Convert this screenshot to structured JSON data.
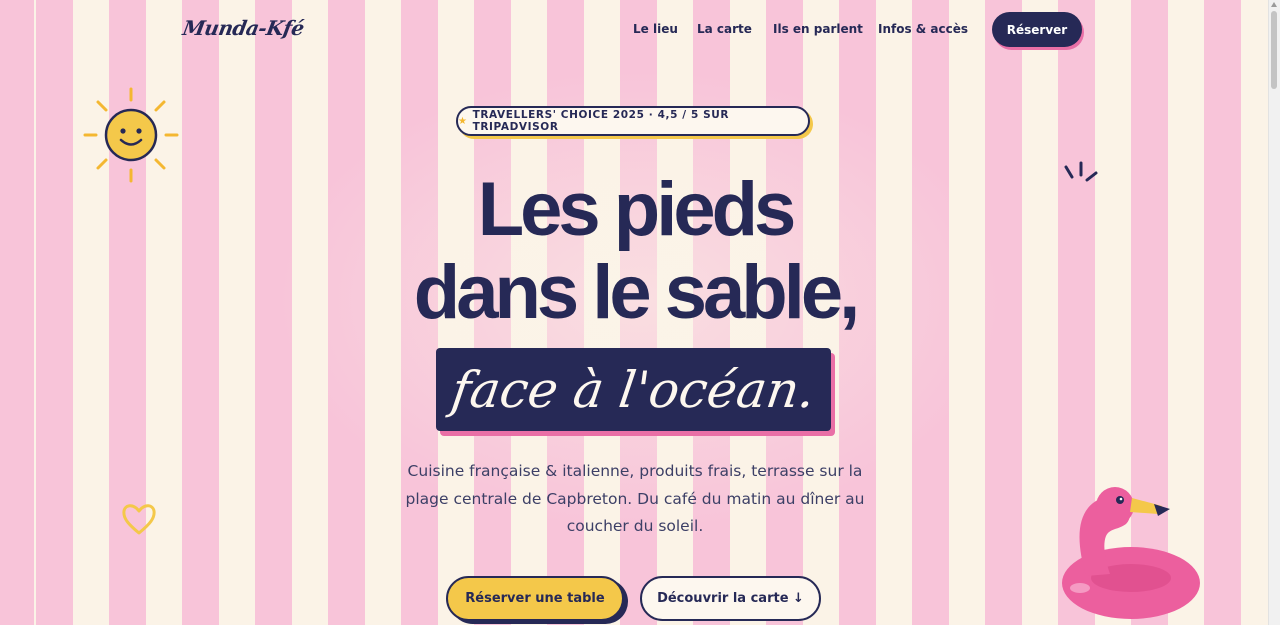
{
  "brand": {
    "logo": "Munda-Kfé"
  },
  "nav": {
    "items": [
      {
        "label": "Le lieu"
      },
      {
        "label": "La carte"
      },
      {
        "label": "Ils en parlent"
      },
      {
        "label": "Infos & accès"
      }
    ],
    "cta_label": "Réserver"
  },
  "hero": {
    "badge_icon": "star-icon",
    "badge": "TRAVELLERS' CHOICE 2025 · 4,5 / 5 SUR TRIPADVISOR",
    "title_line1": "Les pieds",
    "title_line2": "dans le sable,",
    "title_highlight": "face à l'océan.",
    "description": "Cuisine française & italienne, produits frais, terrasse sur la plage centrale de Capbreton. Du café du matin au dîner au coucher du soleil.",
    "primary_cta": "Réserver une table",
    "secondary_cta": "Découvrir la carte ↓"
  },
  "decorations": [
    "sun-icon",
    "heart-icon",
    "sparkle-icon",
    "flamingo-float-icon"
  ],
  "colors": {
    "navy": "#262956",
    "pink": "#f8c4d9",
    "cream": "#fbf3e7",
    "yellow": "#f4c84a",
    "flamingo": "#ec5f9e"
  }
}
